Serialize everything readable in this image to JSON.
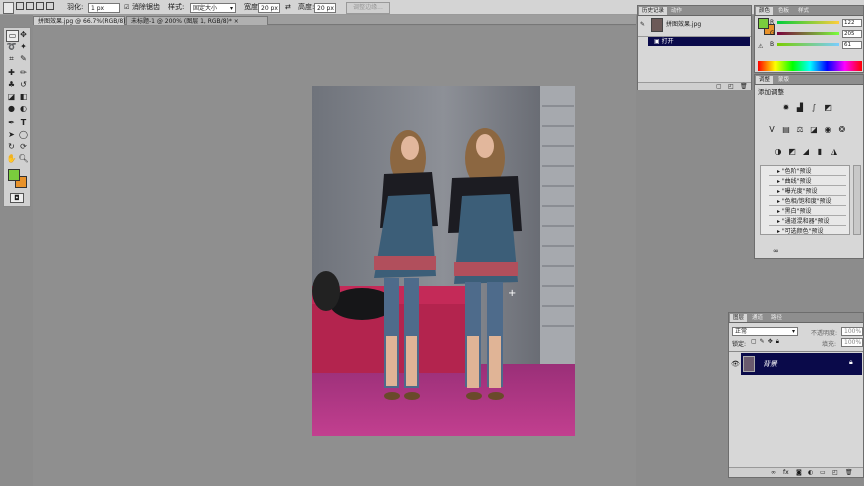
{
  "options_bar": {
    "feather_label": "羽化:",
    "feather_value": "1 px",
    "antialias_label": "消除锯齿",
    "style_label": "样式:",
    "style_value": "固定大小",
    "width_label": "宽度:",
    "width_value": "20 px",
    "height_label": "高度:",
    "height_value": "20 px",
    "refine_button": "调整边缘..."
  },
  "doc_tabs": [
    {
      "label": "拼图效果.jpg @ 66.7%(RGB/8)",
      "close": "×"
    },
    {
      "label": "未标题-1 @ 200% (图层 1, RGB/8)*",
      "close": "×"
    }
  ],
  "history_panel": {
    "tabs": [
      "历史记录",
      "动作"
    ],
    "snapshot_label": "拼图效果.jpg",
    "items": [
      "打开"
    ]
  },
  "color_panel": {
    "tabs": [
      "颜色",
      "色板",
      "样式"
    ],
    "channels": [
      {
        "label": "R",
        "value": "122"
      },
      {
        "label": "G",
        "value": "205"
      },
      {
        "label": "B",
        "value": "61"
      }
    ],
    "foreground": "#7acd3d"
  },
  "adjustments_panel": {
    "tabs": [
      "调整",
      "蒙版"
    ],
    "heading": "添加调整",
    "presets": [
      "\"色阶\"预设",
      "\"曲线\"预设",
      "\"曝光度\"预设",
      "\"色相/饱和度\"预设",
      "\"黑白\"预设",
      "\"通道混和器\"预设",
      "\"可选颜色\"预设"
    ]
  },
  "layers_panel": {
    "tabs": [
      "图层",
      "通道",
      "路径"
    ],
    "blend_mode": "正常",
    "opacity_label": "不透明度:",
    "opacity_value": "100%",
    "lock_label": "锁定:",
    "fill_label": "填充:",
    "fill_value": "100%",
    "layers": [
      {
        "name": "背景"
      }
    ]
  },
  "colors": {
    "foreground": "#7acd3d",
    "background": "#e8922a",
    "accent_selected": "#0a0a4a"
  }
}
